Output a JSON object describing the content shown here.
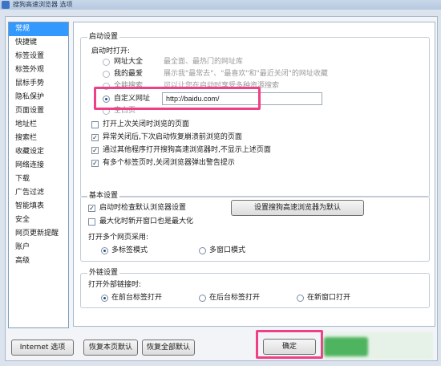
{
  "window": {
    "title": "搜狗高速浏览器 选项"
  },
  "sidebar": {
    "items": [
      "常规",
      "快捷键",
      "标签设置",
      "标签外观",
      "鼠标手势",
      "隐私保护",
      "页面设置",
      "地址栏",
      "搜索栏",
      "收藏设定",
      "网络连接",
      "下载",
      "广告过滤",
      "智能填表",
      "安全",
      "网页更新提醒",
      "账户",
      "高级"
    ],
    "selected": "常规"
  },
  "startup": {
    "title": "启动设置",
    "open_label": "启动时打开:",
    "options": [
      {
        "label": "网址大全",
        "desc": "最全面、最热门的网址库"
      },
      {
        "label": "我的最爱",
        "desc": "展示我\"最常去\"、\"最喜欢\"和\"最近关闭\"的网址收藏"
      },
      {
        "label": "全能搜索",
        "desc": "可以让您在启动时享受多种资源搜索"
      },
      {
        "label": "自定义网址",
        "desc": ""
      },
      {
        "label": "空白页",
        "desc": ""
      }
    ],
    "custom_url": "http://baidu.com/",
    "checks": [
      {
        "label": "打开上次关闭时浏览的页面",
        "checked": false
      },
      {
        "label": "异常关闭后,下次启动恢复崩溃前浏览的页面",
        "checked": true
      },
      {
        "label": "通过其他程序打开搜狗高速浏览器时,不显示上述页面",
        "checked": true
      },
      {
        "label": "有多个标签页时,关闭浏览器弹出警告提示",
        "checked": true
      }
    ]
  },
  "basic": {
    "title": "基本设置",
    "check_default": "启动时检查默认浏览器设置",
    "set_default_button": "设置搜狗高速浏览器为默认",
    "check_maximize": "最大化时新开窗口也是最大化",
    "multi_label": "打开多个网页采用:",
    "multi_options": [
      "多标签模式",
      "多窗口模式"
    ]
  },
  "external": {
    "title": "外链设置",
    "open_label": "打开外部链接时:",
    "options": [
      "在前台标签打开",
      "在后台标签打开",
      "在新窗口打开"
    ]
  },
  "footer": {
    "internet_options": "Internet 选项",
    "restore_page": "恢复本页默认",
    "restore_all": "恢复全部默认",
    "ok": "确定"
  },
  "colors": {
    "highlight": "#ef3f86",
    "selected": "#3399ff"
  }
}
